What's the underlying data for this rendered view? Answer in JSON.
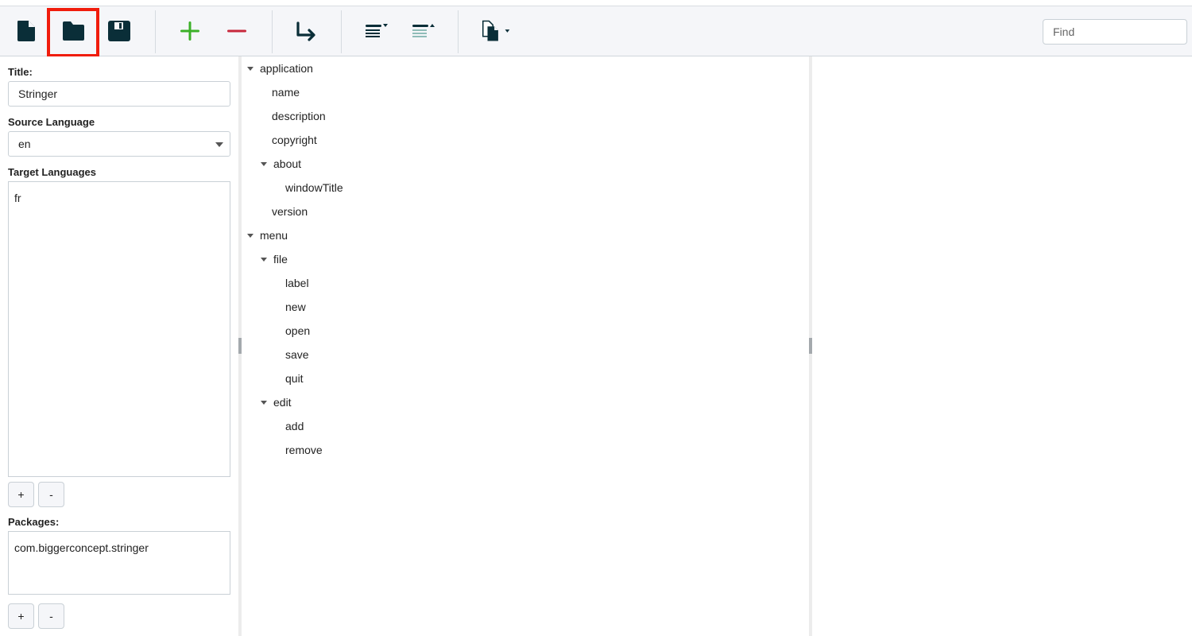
{
  "toolbar": {
    "buttons": [
      {
        "name": "new-file",
        "icon": "file-icon"
      },
      {
        "name": "open-folder",
        "icon": "folder-icon",
        "highlighted": true
      },
      {
        "name": "save",
        "icon": "floppy-disk-icon"
      },
      {
        "name": "add",
        "icon": "plus-icon",
        "color": "#3bb028"
      },
      {
        "name": "remove",
        "icon": "minus-icon",
        "color": "#c8283c"
      },
      {
        "name": "indent",
        "icon": "arrow-turn-right-icon"
      },
      {
        "name": "expand-all",
        "icon": "lines-caret-down-icon"
      },
      {
        "name": "collapse-all",
        "icon": "lines-caret-up-icon"
      },
      {
        "name": "export",
        "icon": "copy-files-dropdown-icon"
      }
    ],
    "find_placeholder": "Find",
    "find_value": ""
  },
  "left_panel": {
    "title_label": "Title:",
    "title_value": "Stringer",
    "source_language_label": "Source Language",
    "source_language_value": "en",
    "target_languages_label": "Target Languages",
    "target_languages": [
      "fr"
    ],
    "add_label": "+",
    "remove_label": "-",
    "packages_label": "Packages:",
    "packages": [
      "com.biggerconcept.stringer"
    ]
  },
  "tree": [
    {
      "label": "application",
      "depth": 0,
      "expanded": true
    },
    {
      "label": "name",
      "depth": 1
    },
    {
      "label": "description",
      "depth": 1
    },
    {
      "label": "copyright",
      "depth": 1
    },
    {
      "label": "about",
      "depth": 1,
      "expanded": true
    },
    {
      "label": "windowTitle",
      "depth": 2
    },
    {
      "label": "version",
      "depth": 1
    },
    {
      "label": "menu",
      "depth": 0,
      "expanded": true
    },
    {
      "label": "file",
      "depth": 1,
      "expanded": true
    },
    {
      "label": "label",
      "depth": 2
    },
    {
      "label": "new",
      "depth": 2
    },
    {
      "label": "open",
      "depth": 2
    },
    {
      "label": "save",
      "depth": 2
    },
    {
      "label": "quit",
      "depth": 2
    },
    {
      "label": "edit",
      "depth": 1,
      "expanded": true
    },
    {
      "label": "add",
      "depth": 2
    },
    {
      "label": "remove",
      "depth": 2
    }
  ],
  "colors": {
    "icon_dark": "#0a2e38",
    "add_green": "#3bb028",
    "remove_red": "#c8283c",
    "collapse_teal": "#8fbcb8",
    "highlight_red": "#f01c0c"
  }
}
